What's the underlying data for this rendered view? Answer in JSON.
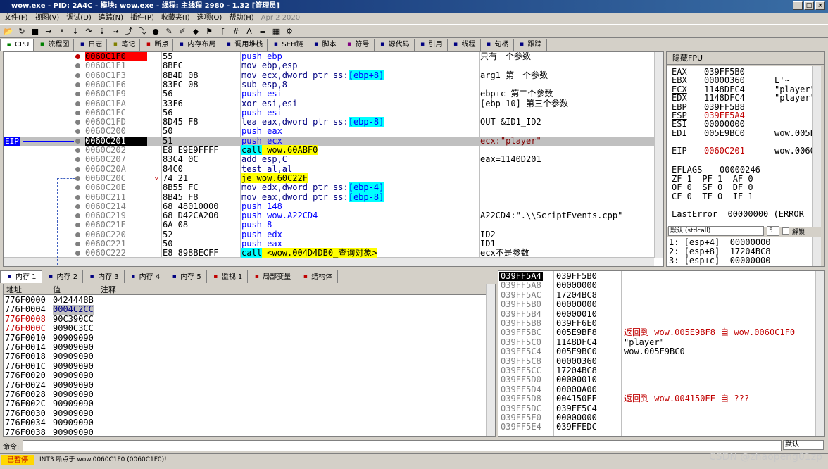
{
  "window": {
    "title": "wow.exe - PID: 2A4C - 模块: wow.exe - 线程: 主线程 2980 - 1.32 [管理员]"
  },
  "menu": [
    "文件(F)",
    "视图(V)",
    "调试(D)",
    "追踪(N)",
    "插件(P)",
    "收藏夹(I)",
    "选项(O)",
    "帮助(H)"
  ],
  "menu_date": "Apr 2 2020",
  "toolbar_icons": [
    "open-icon",
    "restart-icon",
    "stop-icon",
    "run-icon",
    "pause-icon",
    "step-into-icon",
    "step-over-icon",
    "trace-into-icon",
    "trace-over-icon",
    "execute-till-return-icon",
    "execute-till-user-icon",
    "bp-icon",
    "patch-icon",
    "comment-icon",
    "label-icon",
    "bookmark-icon",
    "function-icon",
    "hash-icon",
    "font-icon",
    "strings-icon",
    "calc-icon",
    "settings-icon"
  ],
  "top_tabs": [
    "CPU",
    "流程图",
    "日志",
    "笔记",
    "断点",
    "内存布局",
    "调用堆栈",
    "SEH链",
    "脚本",
    "符号",
    "源代码",
    "引用",
    "线程",
    "句柄",
    "跟踪"
  ],
  "disasm": {
    "eip_label": "EIP",
    "rows": [
      {
        "addr": "0060C1F0",
        "bytes": "55",
        "instr": "push ebp",
        "cmt": "只有一个参数",
        "bp": true
      },
      {
        "addr": "0060C1F1",
        "bytes": "8BEC",
        "instr": "mov ebp,esp",
        "cmt": ""
      },
      {
        "addr": "0060C1F3",
        "bytes": "8B4D 08",
        "instr": "mov ecx,dword ptr ss:[ebp+8]",
        "cmt": "arg1 第一个参数"
      },
      {
        "addr": "0060C1F6",
        "bytes": "83EC 08",
        "instr": "sub esp,8",
        "cmt": ""
      },
      {
        "addr": "0060C1F9",
        "bytes": "56",
        "instr": "push esi",
        "cmt": "ebp+c 第二个参数"
      },
      {
        "addr": "0060C1FA",
        "bytes": "33F6",
        "instr": "xor esi,esi",
        "cmt": "[ebp+10] 第三个参数"
      },
      {
        "addr": "0060C1FC",
        "bytes": "56",
        "instr": "push esi",
        "cmt": ""
      },
      {
        "addr": "0060C1FD",
        "bytes": "8D45 F8",
        "instr": "lea eax,dword ptr ss:[ebp-8]",
        "cmt": "OUT &ID1_ID2"
      },
      {
        "addr": "0060C200",
        "bytes": "50",
        "instr": "push eax",
        "cmt": ""
      },
      {
        "addr": "0060C201",
        "bytes": "51",
        "instr": "push ecx",
        "cmt": "ecx:\"player\"",
        "eip": true
      },
      {
        "addr": "0060C202",
        "bytes": "E8 E9E9FFFF",
        "instr": "call wow.60ABF0",
        "cmt": ""
      },
      {
        "addr": "0060C207",
        "bytes": "83C4 0C",
        "instr": "add esp,C",
        "cmt": "eax=1140D201"
      },
      {
        "addr": "0060C20A",
        "bytes": "84C0",
        "instr": "test al,al",
        "cmt": ""
      },
      {
        "addr": "0060C20C",
        "bytes": "74 21",
        "instr": "je wow.60C22F",
        "cmt": ""
      },
      {
        "addr": "0060C20E",
        "bytes": "8B55 FC",
        "instr": "mov edx,dword ptr ss:[ebp-4]",
        "cmt": ""
      },
      {
        "addr": "0060C211",
        "bytes": "8B45 F8",
        "instr": "mov eax,dword ptr ss:[ebp-8]",
        "cmt": ""
      },
      {
        "addr": "0060C214",
        "bytes": "68 48010000",
        "instr": "push 148",
        "cmt": ""
      },
      {
        "addr": "0060C219",
        "bytes": "68 D42CA200",
        "instr": "push wow.A22CD4",
        "cmt": "A22CD4:\".\\\\ScriptEvents.cpp\""
      },
      {
        "addr": "0060C21E",
        "bytes": "6A 08",
        "instr": "push 8",
        "cmt": ""
      },
      {
        "addr": "0060C220",
        "bytes": "52",
        "instr": "push edx",
        "cmt": "ID2"
      },
      {
        "addr": "0060C221",
        "bytes": "50",
        "instr": "push eax",
        "cmt": "ID1"
      },
      {
        "addr": "0060C222",
        "bytes": "E8 898BECFF",
        "instr": "call <wow.004D4DB0_查询对象>",
        "cmt": "ecx不是参数"
      }
    ]
  },
  "registers": {
    "header": "隐藏FPU",
    "lines": [
      {
        "name": "EAX",
        "val": "039FF5B0",
        "extra": ""
      },
      {
        "name": "EBX",
        "val": "00000360",
        "extra": "L'~"
      },
      {
        "name": "ECX",
        "val": "1148DFC4",
        "extra": "\"player\""
      },
      {
        "name": "EDX",
        "val": "1148DFC4",
        "extra": "\"player\""
      },
      {
        "name": "EBP",
        "val": "039FF5B8",
        "extra": ""
      },
      {
        "name": "ESP",
        "val": "039FF5A4",
        "extra": ""
      },
      {
        "name": "ESI",
        "val": "00000000",
        "extra": ""
      },
      {
        "name": "EDI",
        "val": "005E9BC0",
        "extra": "wow.005E"
      },
      {
        "name": "EIP",
        "val": "0060C201",
        "extra": "wow.0060"
      }
    ],
    "eflags_label": "EFLAGS",
    "eflags_val": "00000246",
    "flags": [
      "ZF 1  PF 1  AF 0",
      "OF 0  SF 0  DF 0",
      "CF 0  TF 0  IF 1"
    ],
    "lasterror": "LastError  00000000 (ERROR",
    "callconv": "默认 (stdcall)",
    "argcount": "5",
    "unlock_label": "解锁",
    "stack_args": [
      "1: [esp+4]  00000000",
      "2: [esp+8]  17204BC8",
      "3: [esp+c]  00000000"
    ]
  },
  "bottom_tabs": [
    "内存 1",
    "内存 2",
    "内存 3",
    "内存 4",
    "内存 5",
    "监视 1",
    "局部变量",
    "结构体"
  ],
  "dump": {
    "headers": {
      "addr": "地址",
      "val": "值",
      "cmt": "注释"
    },
    "rows": [
      {
        "addr": "776F0000",
        "val": "0424448B"
      },
      {
        "addr": "776F0004",
        "val": "0004C2CC"
      },
      {
        "addr": "776F0008",
        "val": "90C390CC",
        "red": true
      },
      {
        "addr": "776F000C",
        "val": "9090C3CC",
        "red": true
      },
      {
        "addr": "776F0010",
        "val": "90909090"
      },
      {
        "addr": "776F0014",
        "val": "90909090"
      },
      {
        "addr": "776F0018",
        "val": "90909090"
      },
      {
        "addr": "776F001C",
        "val": "90909090"
      },
      {
        "addr": "776F0020",
        "val": "90909090"
      },
      {
        "addr": "776F0024",
        "val": "90909090"
      },
      {
        "addr": "776F0028",
        "val": "90909090"
      },
      {
        "addr": "776F002C",
        "val": "90909090"
      },
      {
        "addr": "776F0030",
        "val": "90909090"
      },
      {
        "addr": "776F0034",
        "val": "90909090"
      },
      {
        "addr": "776F0038",
        "val": "90909090"
      }
    ]
  },
  "stack": {
    "rows": [
      {
        "addr": "039FF5A4",
        "val": "039FF5B0",
        "cmt": "",
        "cur": true
      },
      {
        "addr": "039FF5A8",
        "val": "00000000",
        "cmt": ""
      },
      {
        "addr": "039FF5AC",
        "val": "17204BC8",
        "cmt": ""
      },
      {
        "addr": "039FF5B0",
        "val": "00000000",
        "cmt": ""
      },
      {
        "addr": "039FF5B4",
        "val": "00000010",
        "cmt": ""
      },
      {
        "addr": "039FF5B8",
        "val": "039FF6E0",
        "cmt": ""
      },
      {
        "addr": "039FF5BC",
        "val": "005E9BF8",
        "cmt": "返回到 wow.005E9BF8 自 wow.0060C1F0",
        "red": true
      },
      {
        "addr": "039FF5C0",
        "val": "1148DFC4",
        "cmt": "\"player\""
      },
      {
        "addr": "039FF5C4",
        "val": "005E9BC0",
        "cmt": "wow.005E9BC0"
      },
      {
        "addr": "039FF5C8",
        "val": "00000360",
        "cmt": ""
      },
      {
        "addr": "039FF5CC",
        "val": "17204BC8",
        "cmt": ""
      },
      {
        "addr": "039FF5D0",
        "val": "00000010",
        "cmt": ""
      },
      {
        "addr": "039FF5D4",
        "val": "00000A00",
        "cmt": ""
      },
      {
        "addr": "039FF5D8",
        "val": "004150EE",
        "cmt": "返回到 wow.004150EE 自 ???",
        "red": true
      },
      {
        "addr": "039FF5DC",
        "val": "039FF5C4",
        "cmt": ""
      },
      {
        "addr": "039FF5E0",
        "val": "00000000",
        "cmt": ""
      },
      {
        "addr": "039FF5E4",
        "val": "039FFEDC",
        "cmt": ""
      }
    ]
  },
  "command": {
    "label": "命令:",
    "mode": "默认"
  },
  "status": {
    "paused": "已暂停",
    "message": "INT3 断点于 wow.0060C1F0 (0060C1F0)!",
    "watermark": "CSDN @zhaopeng01zp"
  }
}
